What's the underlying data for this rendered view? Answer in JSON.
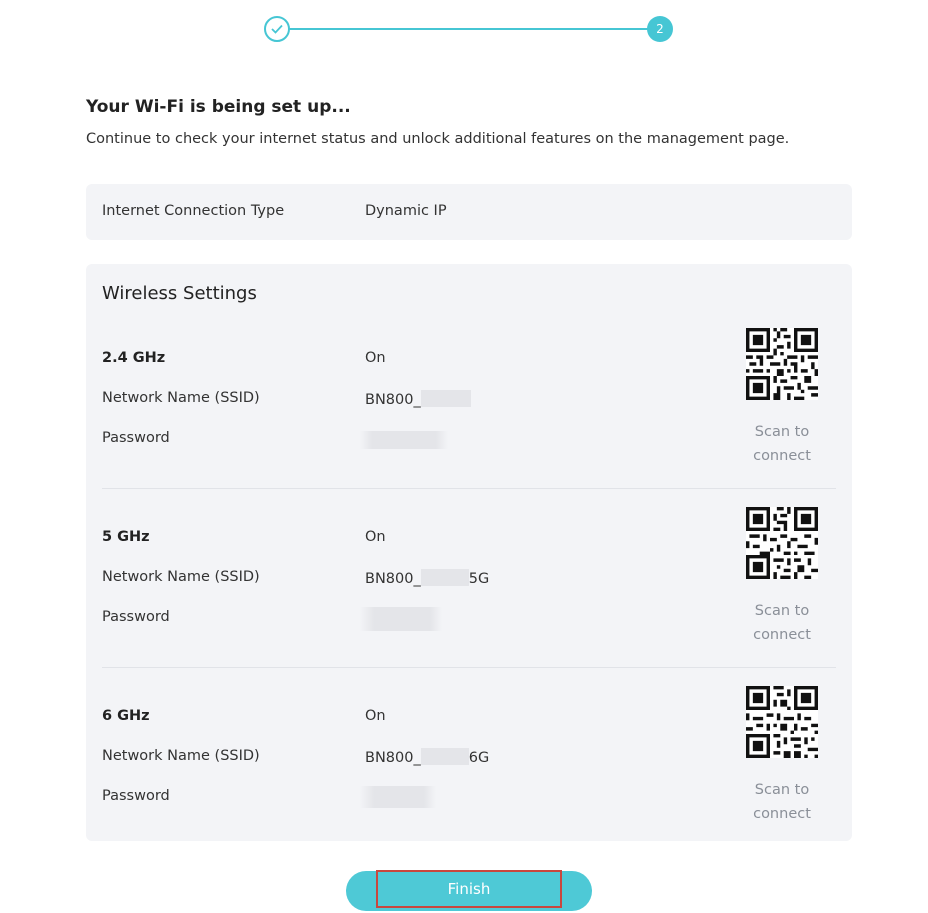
{
  "stepper": {
    "current_step": "2"
  },
  "header": {
    "title": "Your Wi-Fi is being set up...",
    "subtitle": "Continue to check your internet status and unlock additional features on the management page."
  },
  "connection": {
    "label": "Internet Connection Type",
    "value": "Dynamic IP"
  },
  "wireless": {
    "title": "Wireless Settings",
    "ssid_label": "Network Name (SSID)",
    "password_label": "Password",
    "scan_text": "Scan to connect",
    "bands": [
      {
        "name": "2.4 GHz",
        "status": "On",
        "ssid_prefix": "BN800_",
        "ssid_suffix": ""
      },
      {
        "name": "5 GHz",
        "status": "On",
        "ssid_prefix": "BN800_",
        "ssid_suffix": "5G"
      },
      {
        "name": "6 GHz",
        "status": "On",
        "ssid_prefix": "BN800_",
        "ssid_suffix": "6G"
      }
    ]
  },
  "footer": {
    "finish_label": "Finish"
  },
  "colors": {
    "accent": "#46c6d4",
    "button": "#4ec9d6",
    "panel_bg": "#f3f4f7",
    "highlight_border": "#c9473e"
  }
}
